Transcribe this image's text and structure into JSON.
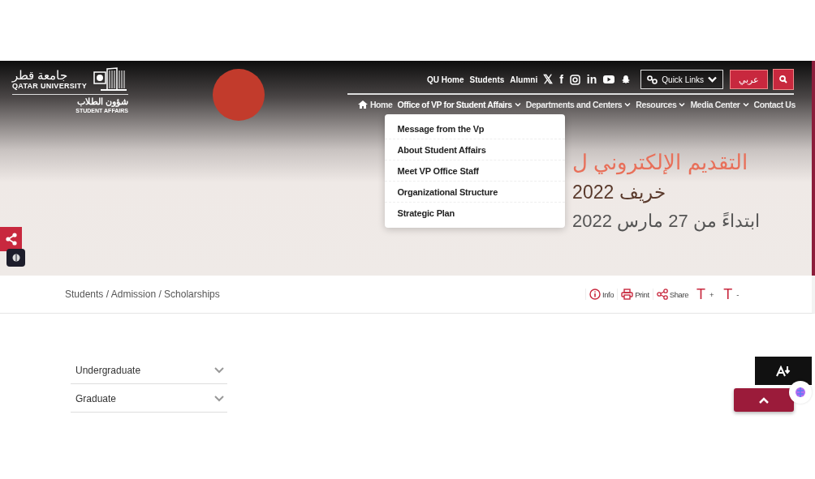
{
  "logo": {
    "arabic_name": "جامعة قطر",
    "english_name": "QATAR UNIVERSITY",
    "unit_arabic": "شؤون الطلاب",
    "unit_english": "STUDENT AFFAIRS"
  },
  "top_links": [
    "QU Home",
    "Students",
    "Alumni"
  ],
  "social": [
    {
      "kind": "x",
      "glyph": "𝕏"
    },
    {
      "kind": "facebook",
      "glyph": "f"
    },
    {
      "kind": "instagram"
    },
    {
      "kind": "linkedin",
      "glyph": "in"
    },
    {
      "kind": "youtube"
    },
    {
      "kind": "snapchat"
    }
  ],
  "quick_links": {
    "label": "Quick Links"
  },
  "language_button": "عربي",
  "nav": [
    {
      "label": "Home",
      "kind": "home"
    },
    {
      "label": "Office of VP for Student Affairs",
      "kind": "dropdown",
      "expanded": true,
      "menu": [
        "Message from the Vp",
        "About Student Affairs",
        "Meet VP Office Staff",
        "Organizational Structure",
        "Strategic Plan"
      ]
    },
    {
      "label": "Departments and Centers",
      "kind": "dropdown",
      "expanded": false
    },
    {
      "label": "Resources",
      "kind": "dropdown",
      "expanded": false
    },
    {
      "label": "Media Center",
      "kind": "dropdown",
      "expanded": false
    },
    {
      "label": "Contact Us",
      "kind": "link"
    }
  ],
  "hero": {
    "title": "التقديم الإلكتروني ل",
    "lines": [
      "خريف 2022",
      "ابتداءً من 27 مارس 2022"
    ]
  },
  "breadcrumb": "Students / Admission / Scholarships",
  "tools": [
    {
      "kind": "info",
      "label": "Info"
    },
    {
      "kind": "print",
      "label": "Print"
    },
    {
      "kind": "share",
      "label": "Share"
    },
    {
      "kind": "larger",
      "icon_text": "T",
      "label": "+"
    },
    {
      "kind": "smaller",
      "icon_text": "T",
      "label": "-"
    }
  ],
  "accordion": [
    {
      "label": "Undergraduate",
      "expanded": false
    },
    {
      "label": "Graduate",
      "expanded": false
    }
  ]
}
